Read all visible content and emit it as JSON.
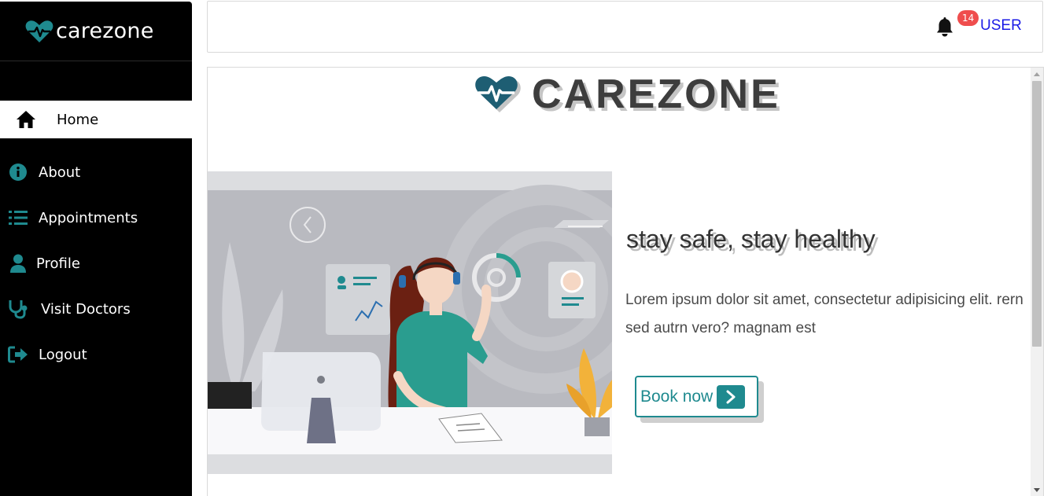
{
  "brand": {
    "name": "carezone",
    "hero_name": "CAREZONE"
  },
  "colors": {
    "accent": "#1f8a8f",
    "sidebar_bg": "#000000",
    "badge": "#ef4d4d",
    "user_link": "#1a1ae6"
  },
  "sidebar": {
    "items": [
      {
        "label": "Home",
        "icon": "home-icon",
        "active": true
      },
      {
        "label": "About",
        "icon": "info-circle-icon"
      },
      {
        "label": "Appointments",
        "icon": "list-icon"
      },
      {
        "label": "Profile",
        "icon": "user-icon"
      },
      {
        "label": "Visit Doctors",
        "icon": "stethoscope-icon"
      },
      {
        "label": "Logout",
        "icon": "logout-icon"
      }
    ]
  },
  "header": {
    "notification_count": "14",
    "user_label": "USER"
  },
  "hero": {
    "headline": "stay safe, stay healthy",
    "description": "Lorem ipsum dolor sit amet, consectetur adipisicing elit. rern sed autrn vero? magnam est",
    "button_label": "Book now"
  }
}
